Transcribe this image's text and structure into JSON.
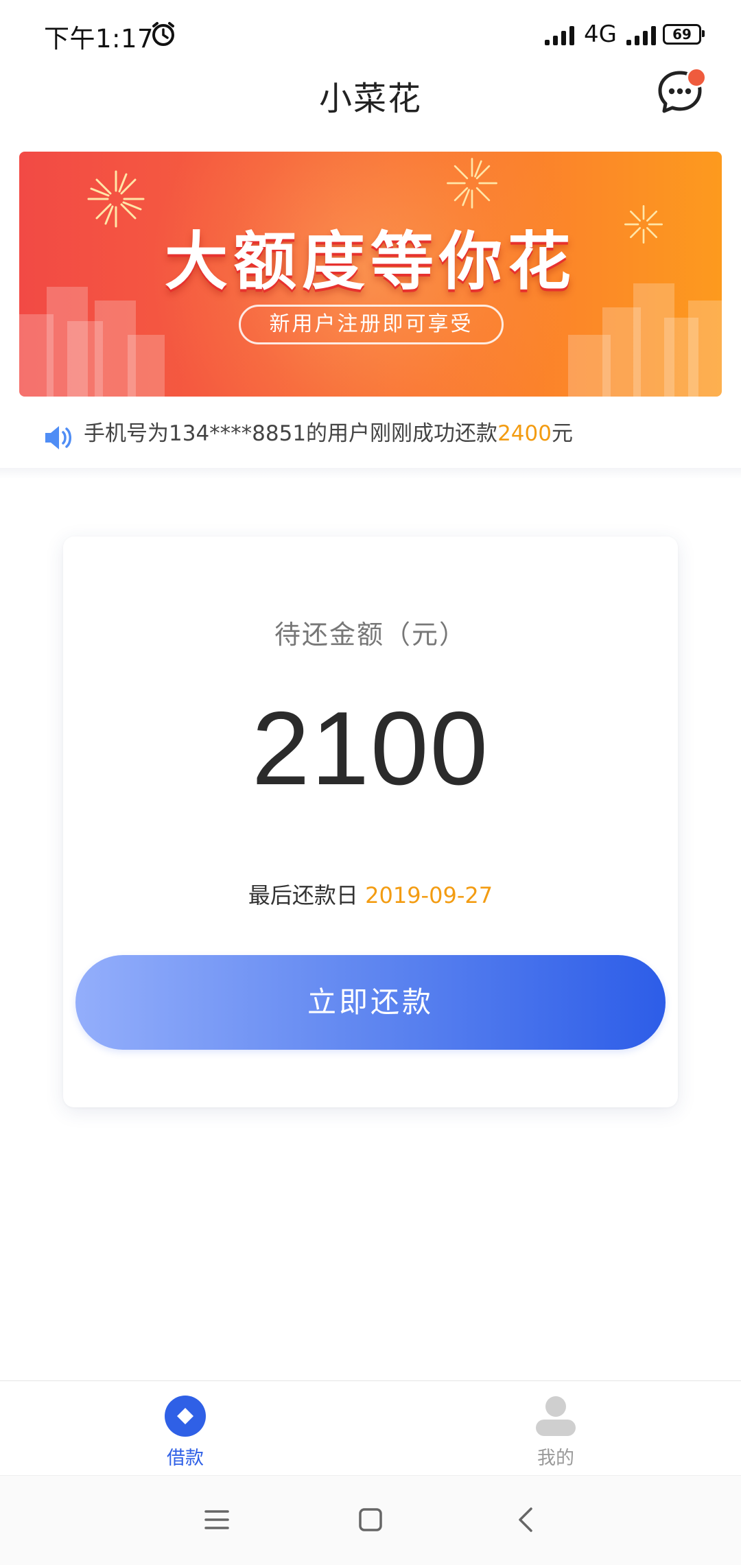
{
  "status_bar": {
    "time": "下午1:17",
    "network": "4G",
    "battery": "69"
  },
  "header": {
    "title": "小菜花"
  },
  "banner": {
    "title": "大额度等你花",
    "subtitle": "新用户注册即可享受"
  },
  "notice": {
    "line1": {
      "prefix": "手机号为134****8851的用户刚刚成功还款",
      "amount": "2400",
      "suffix": "元"
    }
  },
  "repayment": {
    "label": "待还金额（元）",
    "amount": "2100",
    "due_label": "最后还款日",
    "due_date": "2019-09-27",
    "button": "立即还款"
  },
  "bottom_nav": {
    "items": [
      {
        "label": "借款",
        "icon": "loan-icon",
        "active": true
      },
      {
        "label": "我的",
        "icon": "user-icon",
        "active": false
      }
    ]
  },
  "colors": {
    "accent": "#2f60e6",
    "highlight": "#f39c12",
    "banner_start": "#f24a45",
    "banner_end": "#fd9a1e"
  }
}
